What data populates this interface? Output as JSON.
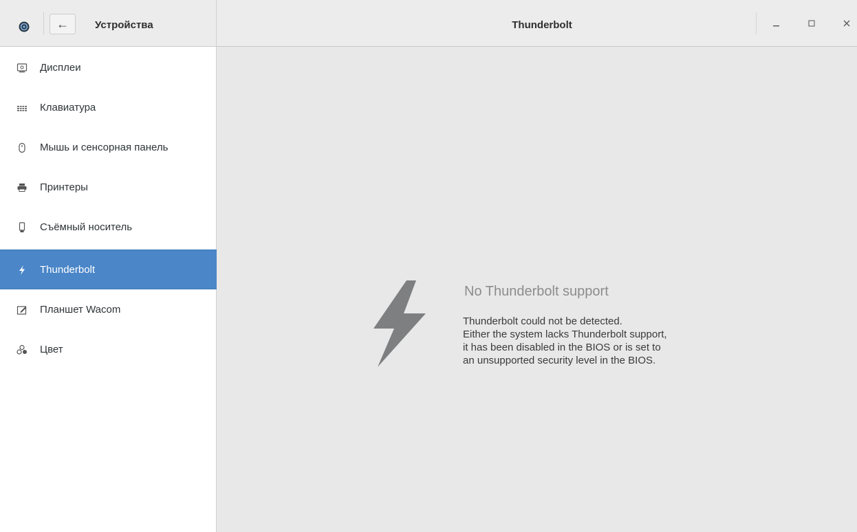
{
  "header": {
    "left_title": "Устройства",
    "title": "Thunderbolt",
    "back_symbol": "←",
    "window_controls": [
      "minimize-icon",
      "maximize-icon",
      "close-icon"
    ]
  },
  "sidebar": {
    "items": [
      {
        "label": "Дисплеи",
        "icon": "display-icon"
      },
      {
        "label": "Клавиатура",
        "icon": "keyboard-icon"
      },
      {
        "label": "Мышь и сенсорная панель",
        "icon": "mouse-icon"
      },
      {
        "label": "Принтеры",
        "icon": "printer-icon"
      },
      {
        "label": "Съёмный носитель",
        "icon": "removable-media-icon"
      },
      {
        "label": "Thunderbolt",
        "icon": "thunderbolt-icon",
        "selected": true
      },
      {
        "label": "Планшет Wacom",
        "icon": "tablet-icon"
      },
      {
        "label": "Цвет",
        "icon": "color-icon"
      }
    ]
  },
  "content": {
    "title": "No Thunderbolt support",
    "body_lines": [
      "Thunderbolt could not be detected.",
      "Either the system lacks Thunderbolt support,",
      "it has been disabled in the BIOS or is set to",
      "an unsupported security level in the BIOS."
    ]
  },
  "colors": {
    "selection": "#4a86c8",
    "sidebar_bg": "#ffffff",
    "content_bg": "#e8e8e8",
    "bolt": "#7d7f80"
  }
}
